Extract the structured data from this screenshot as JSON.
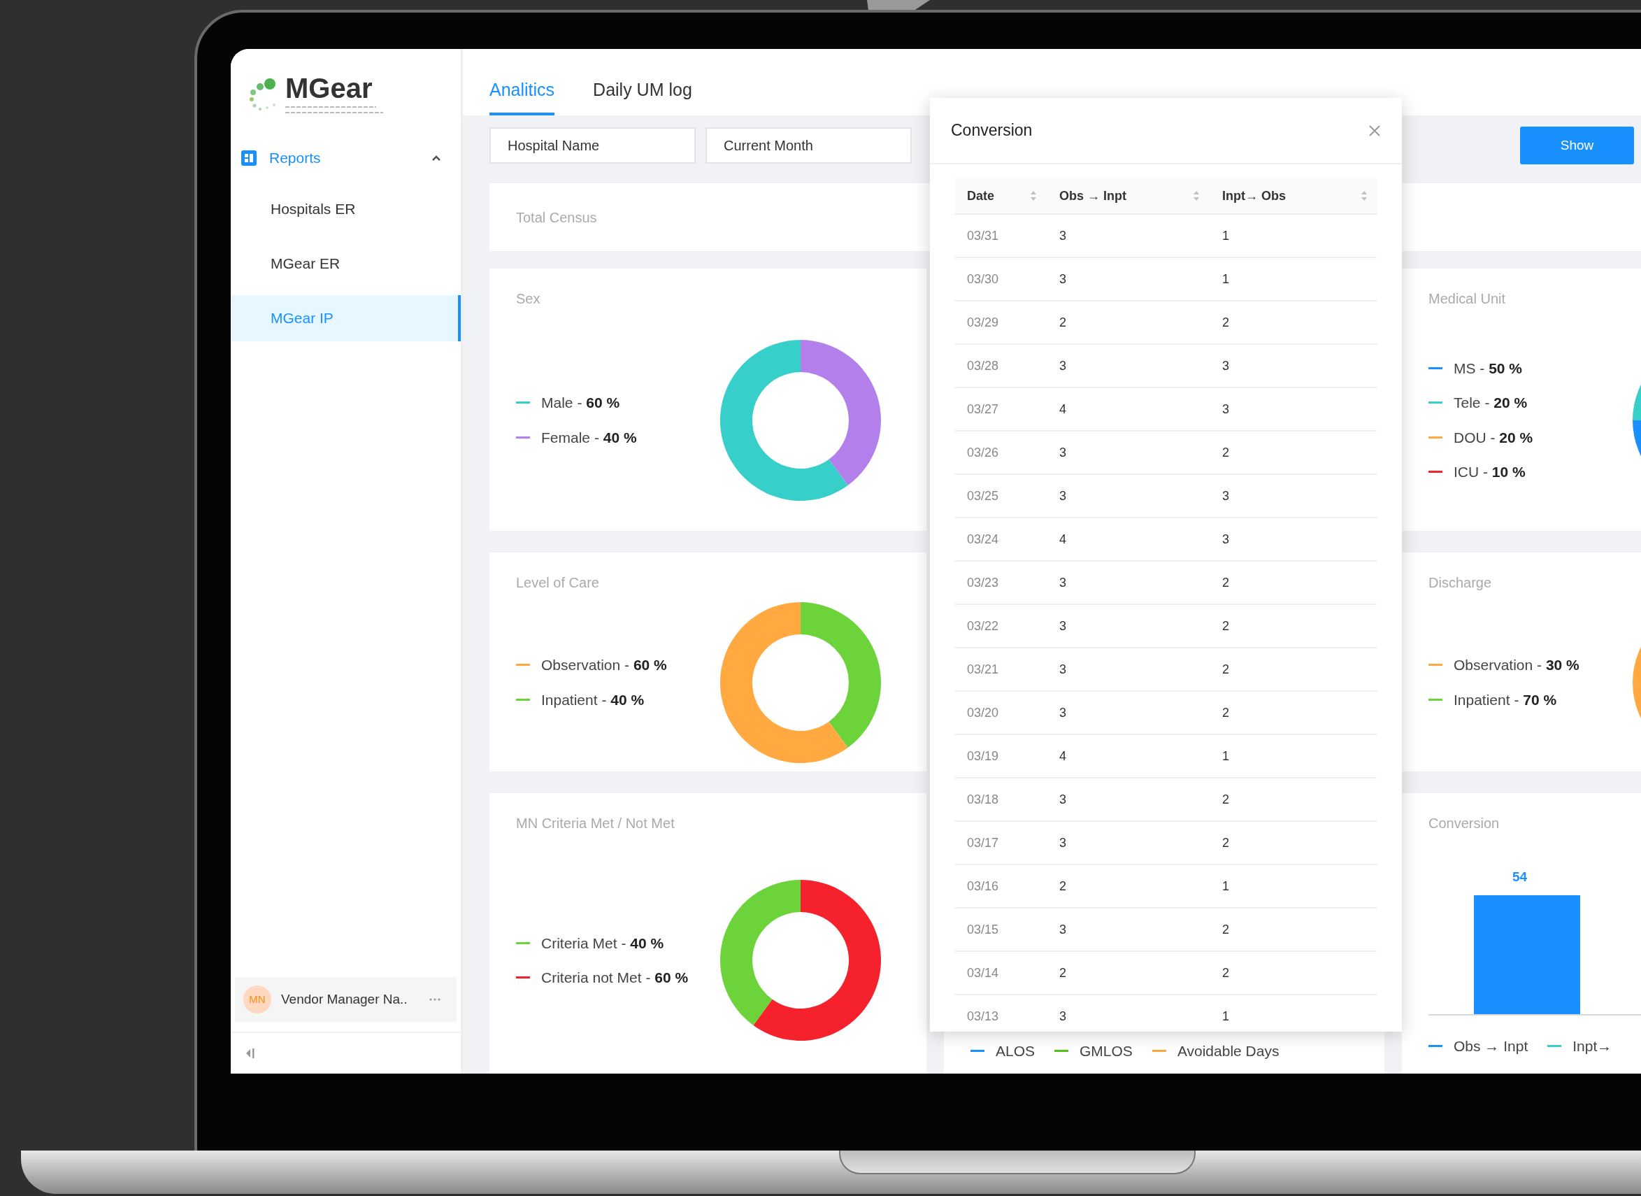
{
  "logo": {
    "name": "MGear"
  },
  "sidebar": {
    "group": {
      "label": "Reports",
      "expanded": true
    },
    "items": [
      {
        "label": "Hospitals ER",
        "selected": false
      },
      {
        "label": "MGear ER",
        "selected": false
      },
      {
        "label": "MGear IP",
        "selected": true
      }
    ]
  },
  "user": {
    "initials": "MN",
    "name": "Vendor Manager Na.."
  },
  "tabs": [
    {
      "label": "Analitics",
      "selected": true
    },
    {
      "label": "Daily UM log",
      "selected": false
    }
  ],
  "filters": [
    {
      "value": "Hospital Name"
    },
    {
      "value": "Current Month"
    }
  ],
  "show_button": "Show",
  "summary_card": {
    "title": "Total Census"
  },
  "columns": [
    [
      {
        "kind": "donut",
        "title": "Sex",
        "legend": [
          {
            "text": "- **60 %**",
            "color": "#36cfc9"
          },
          {
            "text": "- **40 %**",
            "color": "#b37feb"
          }
        ],
        "chart_data": {
          "type": "donut",
          "categories": [
            "Male",
            "Female"
          ],
          "values": [
            60,
            40
          ]
        }
      },
      {
        "kind": "donut",
        "title": "Level of Care",
        "legend": [
          {
            "text": "- **60 %**",
            "color": "#ffa940"
          },
          {
            "text": "- **40 %**",
            "color": "#6dd33b"
          }
        ],
        "chart_data": {
          "type": "donut",
          "categories": [
            "Observation",
            "Inpatient"
          ],
          "values": [
            60,
            40
          ]
        }
      },
      {
        "kind": "donut",
        "title": "MN Criteria Met / Not Met",
        "legend": [
          {
            "text": "- **40 %**",
            "color": "#6dd33b"
          },
          {
            "text": "- **60 %**",
            "color": "#f5222d"
          }
        ],
        "chart_data": {
          "type": "donut",
          "categories": [
            "Criteria Met",
            "Criteria not Met"
          ],
          "values": [
            40,
            60
          ]
        }
      }
    ],
    [
      {
        "kind": "blank"
      },
      {
        "kind": "blank"
      },
      {
        "kind": "legend_only",
        "legend": [
          {
            "label": "ALOS",
            "color": "#1890ff"
          },
          {
            "label": "GMLOS",
            "color": "#52c41a"
          },
          {
            "label": "Avoidable Days",
            "color": "#ffa940"
          }
        ]
      }
    ],
    [
      {
        "kind": "donut_cut",
        "title": "Medical Unit",
        "legend": [
          {
            "label": "MS",
            "text": "- **50 %**",
            "color": "#1890ff"
          },
          {
            "label": "Tele",
            "text": "- **20 %**",
            "color": "#36cfc9"
          },
          {
            "label": "DOU",
            "text": "- **20 %**",
            "color": "#ffa940"
          },
          {
            "label": "ICU",
            "text": "- **10 %**",
            "color": "#f5222d"
          }
        ]
      },
      {
        "kind": "donut_cut",
        "title": "Discharge",
        "legend": [
          {
            "label": "Observation",
            "text": "- **30 %**",
            "color": "#ffa940"
          },
          {
            "label": "Inpatient",
            "text": "- **70 %**",
            "color": "#6dd33b"
          }
        ]
      },
      {
        "kind": "bar_picture",
        "title": "Conversion",
        "bar_label": "54",
        "legend": [
          {
            "label": "Obs → Inpt",
            "color": "#1890ff"
          },
          {
            "label": "Inpt→",
            "color": "#36cfc9"
          }
        ]
      }
    ]
  ],
  "modal": {
    "title": "Conversion",
    "columns": [
      "Date",
      "Obs → Inpt",
      "Inpt→ Obs"
    ],
    "rows": [
      [
        "03/31",
        "3",
        "1"
      ],
      [
        "03/30",
        "3",
        "1"
      ],
      [
        "03/29",
        "2",
        "2"
      ],
      [
        "03/28",
        "3",
        "3"
      ],
      [
        "03/27",
        "4",
        "3"
      ],
      [
        "03/26",
        "3",
        "2"
      ],
      [
        "03/25",
        "3",
        "3"
      ],
      [
        "03/24",
        "4",
        "3"
      ],
      [
        "03/23",
        "3",
        "2"
      ],
      [
        "03/22",
        "3",
        "2"
      ],
      [
        "03/21",
        "3",
        "2"
      ],
      [
        "03/20",
        "3",
        "2"
      ],
      [
        "03/19",
        "4",
        "1"
      ],
      [
        "03/18",
        "3",
        "2"
      ],
      [
        "03/17",
        "3",
        "2"
      ],
      [
        "03/16",
        "2",
        "1"
      ],
      [
        "03/15",
        "3",
        "2"
      ],
      [
        "03/14",
        "2",
        "2"
      ],
      [
        "03/13",
        "3",
        "1"
      ]
    ]
  }
}
